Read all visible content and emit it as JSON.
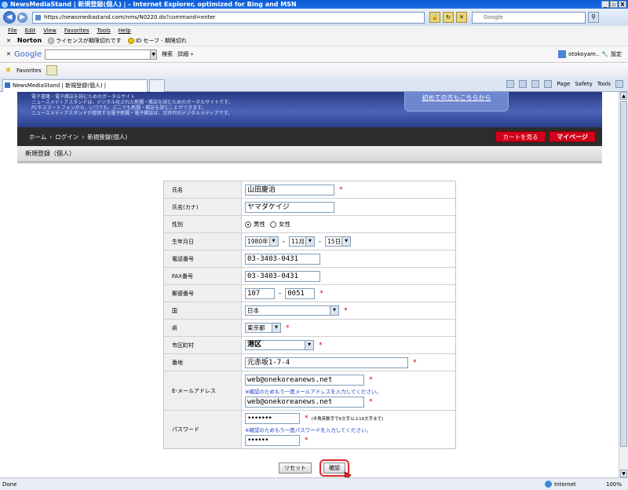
{
  "window": {
    "title": "NewsMediaStand | 新規登録(個人) | - Internet Explorer, optimized for Bing and MSN",
    "controls": [
      "_",
      "▫",
      "X"
    ]
  },
  "address": {
    "url": "https://newsmediastand.com/nms/N0220.do?command=enter",
    "search_placeholder": "Google"
  },
  "menu": [
    "File",
    "Edit",
    "View",
    "Favorites",
    "Tools",
    "Help"
  ],
  "norton": {
    "brand": "Norton",
    "license": "ライセンスが期限切れです",
    "idsafe": "ID セーフ - 期限切れ"
  },
  "google": {
    "brand": "Google",
    "search_btn": "検索",
    "more": "詳細 »",
    "user": "otokoyam..",
    "settings": "設定"
  },
  "favorites": {
    "label": "Favorites"
  },
  "tab": {
    "title": "NewsMediaStand | 新規登録(個人) |"
  },
  "commandbar": [
    "Page",
    "Safety",
    "Tools"
  ],
  "banner": {
    "lines": [
      "電子書籍・電子雑誌を読むためのポータルサイト",
      "ニュースメディアスタンドは、デジタル化された新聞・雑誌を読むためのポータルサイトです。",
      "PCやスマートフォンから、いつでも、どこでも新聞・雑誌を読むことができます。",
      "ニュースメディアスタンドが提供する電子新聞・電子雑誌は、次世代のデジタルメディアです。"
    ],
    "first_time": "初めての方もこちらから"
  },
  "breadcrumb": {
    "home": "ホーム",
    "login": "ログイン",
    "current": "新規登録(個人)"
  },
  "header_buttons": {
    "cart": "カートを見る",
    "mypage": "マイページ"
  },
  "section_title": "新規登録（個人）",
  "form": {
    "labels": {
      "name": "氏名",
      "kana": "氏名(カナ)",
      "gender": "性別",
      "birthday": "生年月日",
      "phone": "電話番号",
      "fax": "FAX番号",
      "zip": "郵便番号",
      "country": "国",
      "prefecture": "県",
      "city": "市区町村",
      "address": "番地",
      "email": "E-メールアドレス",
      "password": "パスワード"
    },
    "values": {
      "name": "山田慶治",
      "kana": "ヤマダケイジ",
      "gender_male": "男性",
      "gender_female": "女性",
      "year": "1980年",
      "month": "11月",
      "day": "15日",
      "phone": "03-3403-0431",
      "fax": "03-3403-0431",
      "zip1": "107",
      "zip2": "0051",
      "country": "日本",
      "prefecture": "東京都",
      "city": "港区",
      "address": "元赤坂1-7-4",
      "email": "web@onekoreanews.net",
      "email_confirm": "web@onekoreanews.net",
      "password": "•••••••",
      "password_confirm": "••••••"
    },
    "notes": {
      "email_confirm": "※確認のためもう一度メールアドレスを入力してください。",
      "password_hint": "(半角英数字で6文字以上16文字まで)",
      "password_confirm": "※確認のためもう一度パスワードを入力してください。"
    },
    "required_mark": "*",
    "date_separator": "-"
  },
  "actions": {
    "reset": "リセット",
    "confirm": "確認"
  },
  "status": {
    "left": "Done",
    "zone": "Internet",
    "zoom": "100%"
  }
}
